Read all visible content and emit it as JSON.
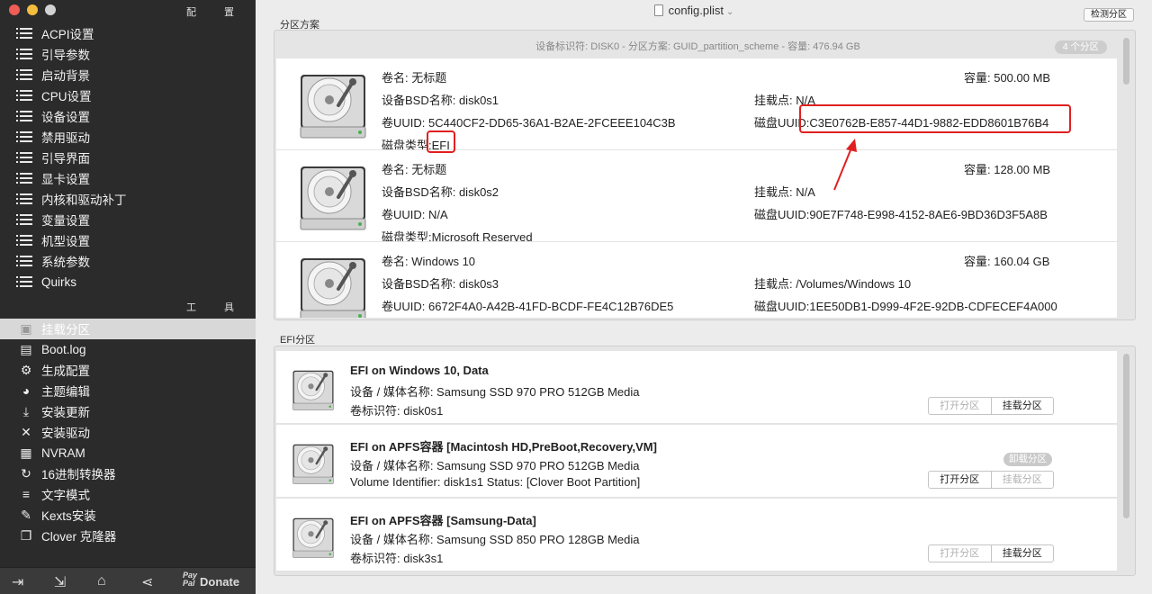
{
  "window": {
    "title": "config.plist"
  },
  "sidebar": {
    "section_config": "配 置",
    "config_items": [
      "ACPI设置",
      "引导参数",
      "启动背景",
      "CPU设置",
      "设备设置",
      "禁用驱动",
      "引导界面",
      "显卡设置",
      "内核和驱动补丁",
      "变量设置",
      "机型设置",
      "系统参数",
      "Quirks"
    ],
    "section_tools": "工 具",
    "tool_items": [
      {
        "label": "挂载分区",
        "icon": "disk-icon",
        "selected": true
      },
      {
        "label": "Boot.log",
        "icon": "log-icon"
      },
      {
        "label": "生成配置",
        "icon": "gear-icon"
      },
      {
        "label": "主题编辑",
        "icon": "palette-icon"
      },
      {
        "label": "安装更新",
        "icon": "download-icon"
      },
      {
        "label": "安装驱动",
        "icon": "wrench-icon"
      },
      {
        "label": "NVRAM",
        "icon": "chip-icon"
      },
      {
        "label": "16进制转换器",
        "icon": "refresh-icon"
      },
      {
        "label": "文字模式",
        "icon": "text-icon"
      },
      {
        "label": "Kexts安装",
        "icon": "puzzle-icon"
      },
      {
        "label": "Clover 克隆器",
        "icon": "copy-icon"
      }
    ],
    "bottom": {
      "donate_label": "Donate",
      "paypal_text": "Pay Pal"
    }
  },
  "toolbar": {
    "detect_label": "检测分区"
  },
  "partition_scheme": {
    "section_label": "分区方案",
    "disk_header": "设备标识符: DISK0 - 分区方案: GUID_partition_scheme - 容量: 476.94 GB",
    "count_badge": "4 个分区",
    "rows": [
      {
        "volume": "卷名: 无标题",
        "capacity": "容量:  500.00 MB",
        "bsd": "设备BSD名称: disk0s1",
        "mount": "挂载点: N/A",
        "vol_uuid": "卷UUID: 5C440CF2-DD65-36A1-B2AE-2FCEEE104C3B",
        "disk_uuid": "磁盘UUID:C3E0762B-E857-44D1-9882-EDD8601B76B4",
        "type_label": "磁盘类型:",
        "type_value": "EFI"
      },
      {
        "volume": "卷名: 无标题",
        "capacity": "容量:  128.00 MB",
        "bsd": "设备BSD名称: disk0s2",
        "mount": "挂载点: N/A",
        "vol_uuid": "卷UUID: N/A",
        "disk_uuid": "磁盘UUID:90E7F748-E998-4152-8AE6-9BD36D3F5A8B",
        "type_label": "磁盘类型:",
        "type_value": "Microsoft Reserved"
      },
      {
        "volume": "卷名: Windows 10",
        "capacity": "容量:  160.04 GB",
        "bsd": "设备BSD名称: disk0s3",
        "mount": "挂载点: /Volumes/Windows 10",
        "vol_uuid": "卷UUID: 6672F4A0-A42B-41FD-BCDF-FE4C12B76DE5",
        "disk_uuid": "磁盘UUID:1EE50DB1-D999-4F2E-92DB-CDFECEF4A000",
        "type_label": "",
        "type_value": ""
      }
    ]
  },
  "efi_partitions": {
    "section_label": "EFI分区",
    "rows": [
      {
        "title": "EFI on Windows 10, Data",
        "media": "设备 / 媒体名称: Samsung SSD 970 PRO 512GB Media",
        "ident": "卷标识符: disk0s1",
        "open_label": "打开分区",
        "mount_label": "挂载分区",
        "open_enabled": false,
        "mount_enabled": true,
        "unmount_label": ""
      },
      {
        "title": "EFI on APFS容器 [Macintosh HD,PreBoot,Recovery,VM]",
        "media": "设备 / 媒体名称: Samsung SSD 970 PRO 512GB Media",
        "ident": "Volume Identifier: disk1s1 Status: [Clover Boot Partition]",
        "open_label": "打开分区",
        "mount_label": "挂载分区",
        "open_enabled": true,
        "mount_enabled": false,
        "unmount_label": "卸载分区"
      },
      {
        "title": "EFI on APFS容器 [Samsung-Data]",
        "media": "设备 / 媒体名称: Samsung SSD 850 PRO 128GB Media",
        "ident": "卷标识符: disk3s1",
        "open_label": "打开分区",
        "mount_label": "挂载分区",
        "open_enabled": false,
        "mount_enabled": true,
        "unmount_label": ""
      }
    ]
  },
  "colors": {
    "highlight": "#e02020",
    "sidebar_bg": "#2b2b2b"
  }
}
